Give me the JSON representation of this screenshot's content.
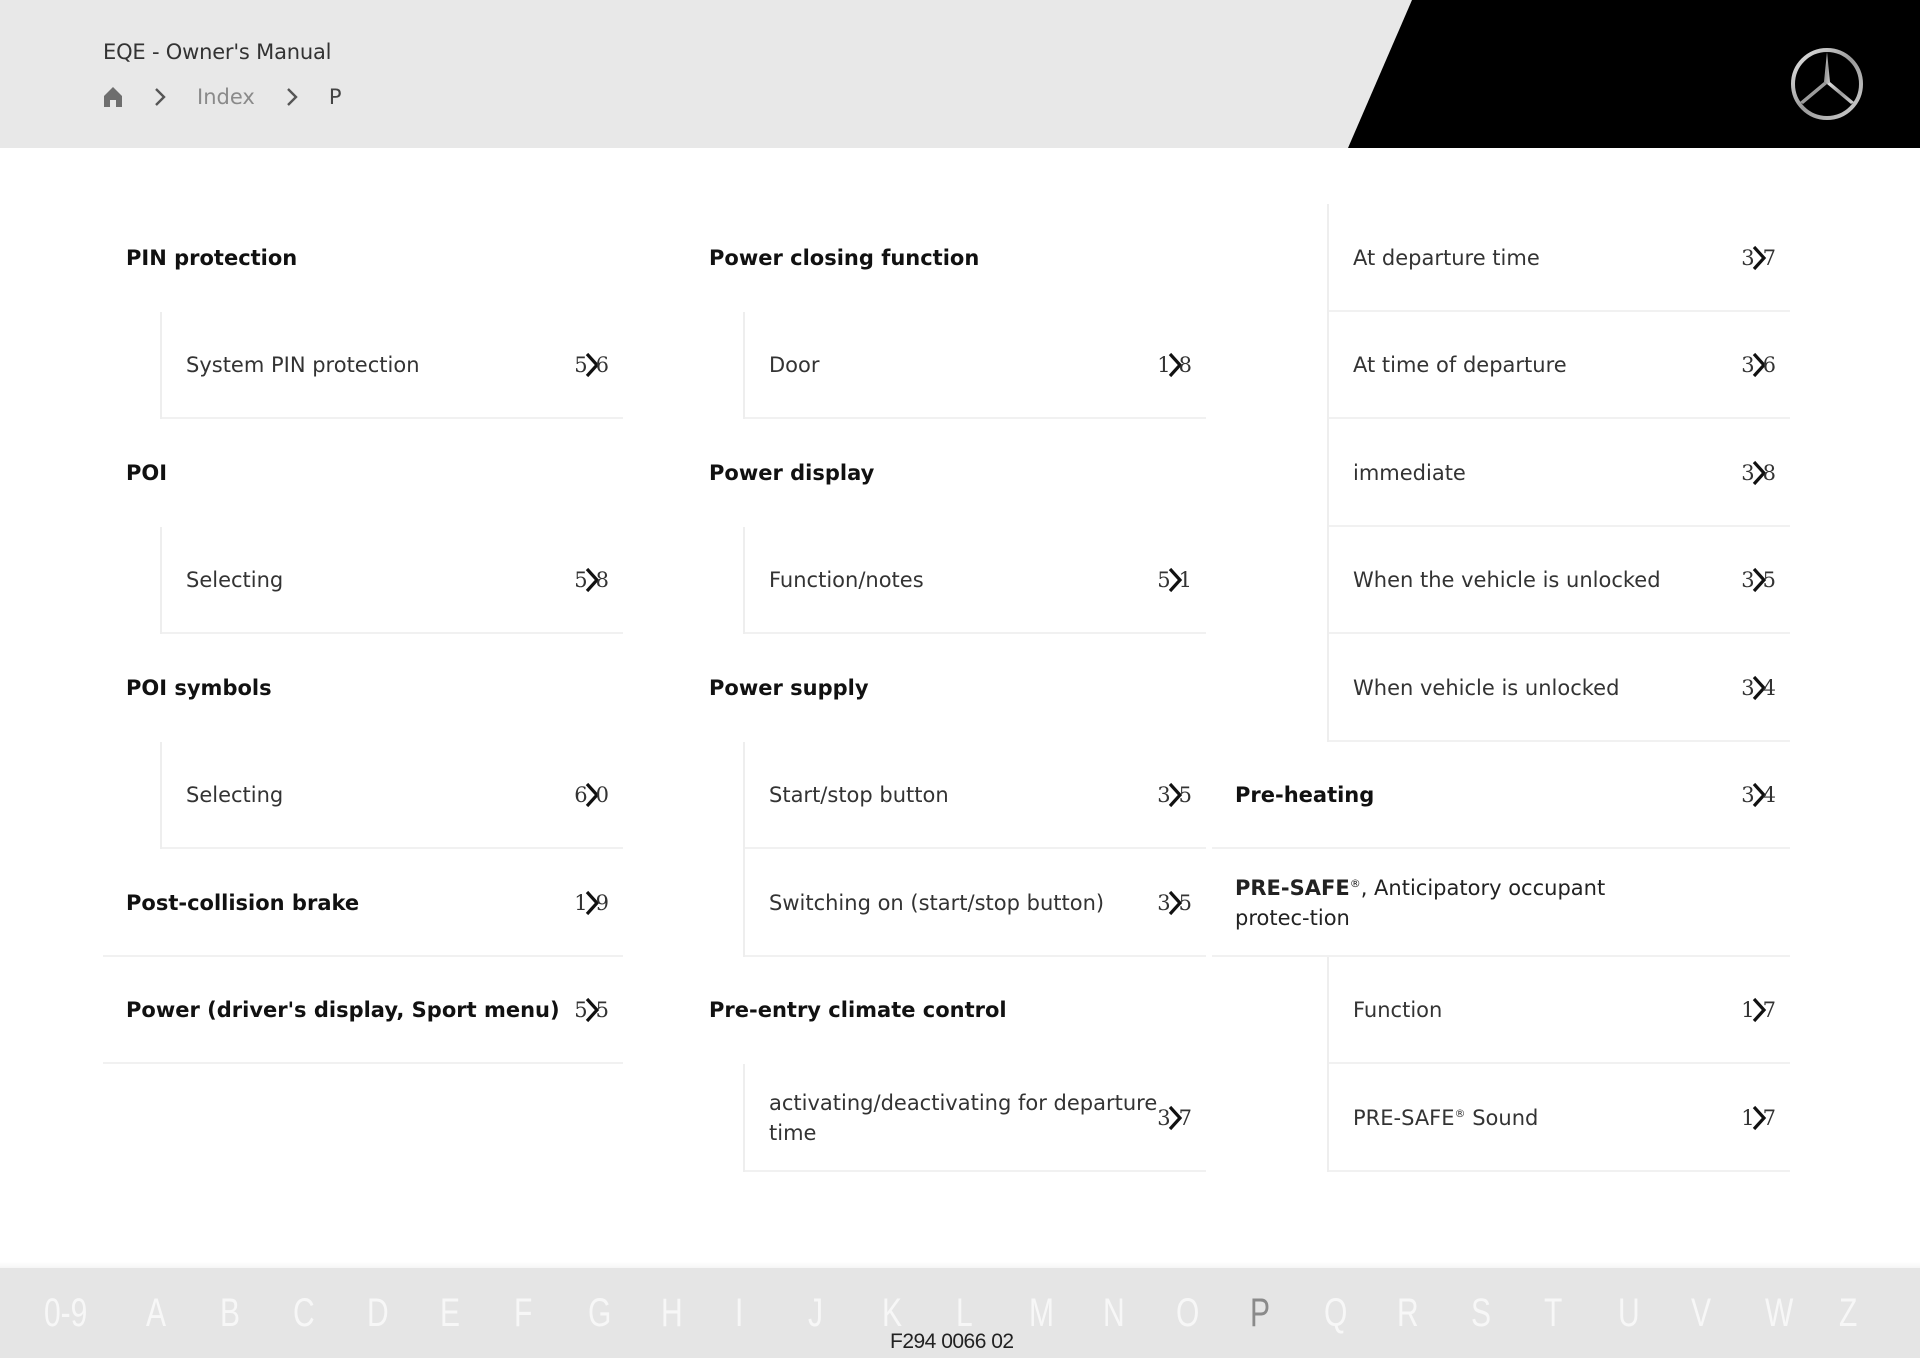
{
  "header": {
    "app_title": "EQE - Owner's Manual",
    "breadcrumb": {
      "home_icon": "home-icon",
      "items": [
        {
          "label": "Index"
        },
        {
          "label": "P"
        }
      ]
    },
    "logo": "mercedes-star-logo",
    "colors": {
      "header_bg": "#e8e8e8",
      "brand_black": "#000000"
    }
  },
  "columns": [
    {
      "entries": [
        {
          "type": "main",
          "label": "PIN protection"
        },
        {
          "type": "sub",
          "label": "System PIN protection",
          "page_first": "5",
          "page_last": "6"
        },
        {
          "type": "main",
          "label": "POI"
        },
        {
          "type": "sub",
          "label": "Selecting",
          "page_first": "5",
          "page_last": "8"
        },
        {
          "type": "main",
          "label": "POI symbols"
        },
        {
          "type": "sub",
          "label": "Selecting",
          "page_first": "6",
          "page_last": "0"
        },
        {
          "type": "main",
          "label": "Post-collision brake",
          "page_first": "1",
          "page_last": "9"
        },
        {
          "type": "main",
          "label": "Power (driver's display, Sport menu)",
          "page_first": "5",
          "page_last": "5"
        }
      ]
    },
    {
      "entries": [
        {
          "type": "main",
          "label": "Power closing function"
        },
        {
          "type": "sub",
          "label": "Door",
          "page_first": "1",
          "page_last": "8"
        },
        {
          "type": "main",
          "label": "Power display"
        },
        {
          "type": "sub",
          "label": "Function/notes",
          "page_first": "5",
          "page_last": "1"
        },
        {
          "type": "main",
          "label": "Power supply"
        },
        {
          "type": "sub",
          "label": "Start/stop button",
          "page_first": "3",
          "page_last": "5"
        },
        {
          "type": "sub",
          "label": "Switching on (start/stop button)",
          "page_first": "3",
          "page_last": "5"
        },
        {
          "type": "main",
          "label": "Pre-entry climate control"
        },
        {
          "type": "sub",
          "label": "activating/deactivating for departure time",
          "page_first": "3",
          "page_last": "7"
        }
      ]
    },
    {
      "entries": [
        {
          "type": "sub",
          "label": "At departure time",
          "page_first": "3",
          "page_last": "7"
        },
        {
          "type": "sub",
          "label": "At time of departure",
          "page_first": "3",
          "page_last": "6"
        },
        {
          "type": "sub",
          "label": "immediate",
          "page_first": "3",
          "page_last": "8"
        },
        {
          "type": "sub",
          "label": "When the vehicle is unlocked",
          "page_first": "3",
          "page_last": "5"
        },
        {
          "type": "sub",
          "label": "When vehicle is unlocked",
          "page_first": "3",
          "page_last": "4"
        },
        {
          "type": "main",
          "label": "Pre-heating",
          "page_first": "3",
          "page_last": "4"
        },
        {
          "type": "main-rich",
          "label_bold": "PRE-SAFE",
          "label_sup": "®",
          "label_rest": ", Anticipatory occupant protec-tion"
        },
        {
          "type": "sub",
          "label": "Function",
          "page_first": "1",
          "page_last": "7"
        },
        {
          "type": "sub-rich",
          "label_pre": "PRE-SAFE",
          "label_sup": "®",
          "label_rest": " Sound",
          "page_first": "1",
          "page_last": "7"
        }
      ]
    }
  ],
  "alphabet_bar": {
    "letters": [
      "0-9",
      "A",
      "B",
      "C",
      "D",
      "E",
      "F",
      "G",
      "H",
      "I",
      "J",
      "K",
      "L",
      "M",
      "N",
      "O",
      "P",
      "Q",
      "R",
      "S",
      "T",
      "U",
      "V",
      "W",
      "Z"
    ],
    "active": "P",
    "doc_code": "F294 0066 02"
  }
}
